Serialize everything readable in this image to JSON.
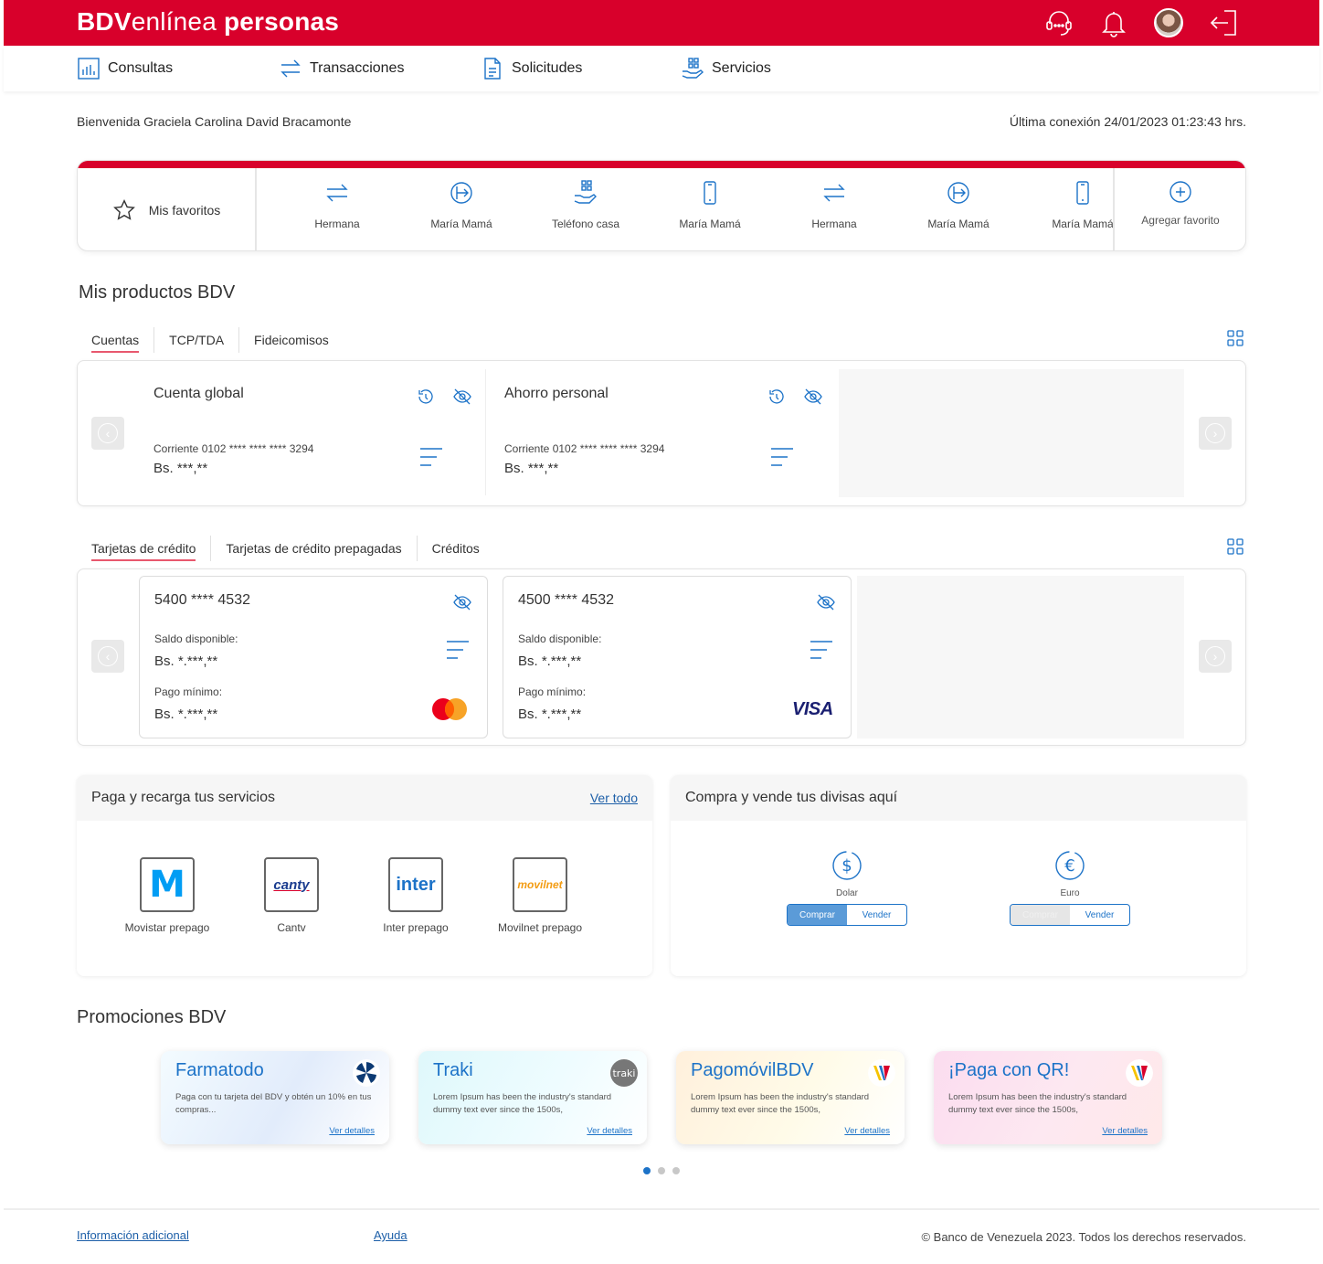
{
  "header": {
    "brand_bold": "BDV",
    "brand_light": "enlínea",
    "brand_tail": "personas",
    "icons": [
      "support-icon",
      "bell-icon",
      "avatar",
      "logout-icon"
    ]
  },
  "nav": {
    "items": [
      {
        "label": "Consultas",
        "icon": "chart-icon"
      },
      {
        "label": "Transacciones",
        "icon": "transfer-icon"
      },
      {
        "label": "Solicitudes",
        "icon": "document-icon"
      },
      {
        "label": "Servicios",
        "icon": "services-icon"
      }
    ]
  },
  "welcome": "Bienvenida Graciela Carolina David Bracamonte",
  "last_connection": "Última conexión 24/01/2023 01:23:43 hrs.",
  "favorites": {
    "label": "Mis favoritos",
    "items": [
      {
        "label": "Hermana",
        "icon": "transfer-icon"
      },
      {
        "label": "María Mamá",
        "icon": "payment-icon"
      },
      {
        "label": "Teléfono casa",
        "icon": "services-icon"
      },
      {
        "label": "María Mamá",
        "icon": "phone-icon"
      },
      {
        "label": "Hermana",
        "icon": "transfer-icon"
      },
      {
        "label": "María Mamá",
        "icon": "payment-icon"
      },
      {
        "label": "María Mamá",
        "icon": "phone-icon"
      }
    ],
    "add_label": "Agregar favorito"
  },
  "products": {
    "title": "Mis productos BDV",
    "account_tabs": [
      "Cuentas",
      "TCP/TDA",
      "Fideicomisos"
    ],
    "accounts": [
      {
        "name": "Cuenta global",
        "number": "Corriente 0102 **** **** **** 3294",
        "balance": "Bs. ***,**"
      },
      {
        "name": "Ahorro personal",
        "number": "Corriente 0102 **** **** **** 3294",
        "balance": "Bs. ***,**"
      }
    ],
    "card_tabs": [
      "Tarjetas de crédito",
      "Tarjetas de crédito prepagadas",
      "Créditos"
    ],
    "cards": [
      {
        "number": "5400 **** 4532",
        "available_label": "Saldo disponible:",
        "available": "Bs. *.***,**",
        "min_label": "Pago mínimo:",
        "min": "Bs. *.***,**",
        "brand": "mastercard"
      },
      {
        "number": "4500 **** 4532",
        "available_label": "Saldo disponible:",
        "available": "Bs. *.***,**",
        "min_label": "Pago mínimo:",
        "min": "Bs. *.***,**",
        "brand": "VISA"
      }
    ]
  },
  "services": {
    "title": "Paga y recarga tus servicios",
    "see_all": "Ver todo",
    "items": [
      {
        "label": "Movistar prepago",
        "logo": "M"
      },
      {
        "label": "Cantv",
        "logo": "canty"
      },
      {
        "label": "Inter prepago",
        "logo": "inter"
      },
      {
        "label": "Movilnet prepago",
        "logo": "movilnet"
      }
    ]
  },
  "currency": {
    "title": "Compra y vende tus divisas aquí",
    "items": [
      {
        "label": "Dolar",
        "symbol": "$",
        "buy": "Comprar",
        "sell": "Vender"
      },
      {
        "label": "Euro",
        "symbol": "€",
        "buy": "Comprar",
        "sell": "Vender"
      }
    ]
  },
  "promotions": {
    "title": "Promociones BDV",
    "items": [
      {
        "title": "Farmatodo",
        "desc": "Paga con tu tarjeta del BDV y obtén un 10% en tus compras...",
        "link": "Ver detalles"
      },
      {
        "title": "Traki",
        "badge": "traki",
        "desc": "Lorem Ipsum has been the industry's standard dummy text ever since the 1500s,",
        "link": "Ver detalles"
      },
      {
        "title": "PagomóvilBDV",
        "desc": "Lorem Ipsum has been the industry's standard dummy text ever since the 1500s,",
        "link": "Ver detalles"
      },
      {
        "title": "¡Paga con QR!",
        "desc": "Lorem Ipsum has been the industry's standard dummy text ever since the 1500s,",
        "link": "Ver detalles"
      }
    ],
    "active_page": 1,
    "pages": 3
  },
  "footer": {
    "info": "Información adicional",
    "help": "Ayuda",
    "copyright": "© Banco de Venezuela 2023. Todos los derechos reservados."
  },
  "colors": {
    "brand_red": "#d8002b",
    "accent_blue": "#1d73c8"
  }
}
